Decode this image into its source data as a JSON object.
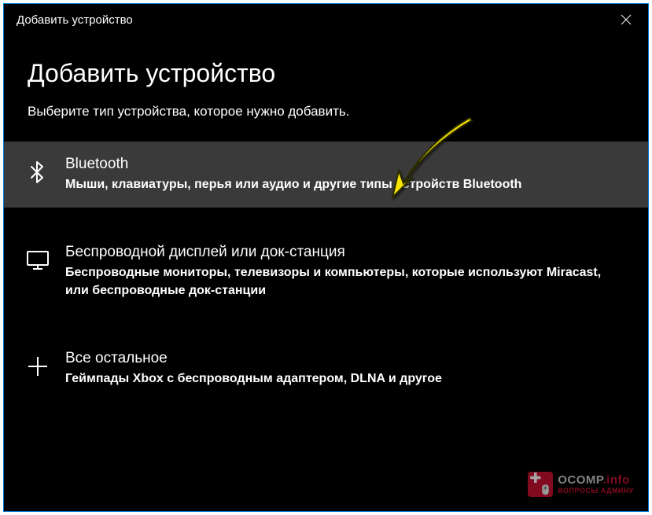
{
  "titlebar": {
    "text": "Добавить устройство"
  },
  "heading": "Добавить устройство",
  "subtitle": "Выберите тип устройства, которое нужно добавить.",
  "options": {
    "bluetooth": {
      "title": "Bluetooth",
      "desc": "Мыши, клавиатуры, перья или аудио и другие типы устройств Bluetooth"
    },
    "wireless": {
      "title": "Беспроводной дисплей или док-станция",
      "desc": "Беспроводные мониторы, телевизоры и компьютеры, которые используют Miracast, или беспроводные док-станции"
    },
    "other": {
      "title": "Все остальное",
      "desc": "Геймпады Xbox с беспроводным адаптером, DLNA и другое"
    }
  },
  "badge": {
    "brand": "OCOMP",
    "suffix": ".info",
    "tagline": "ВОПРОСЫ АДМИНУ"
  }
}
